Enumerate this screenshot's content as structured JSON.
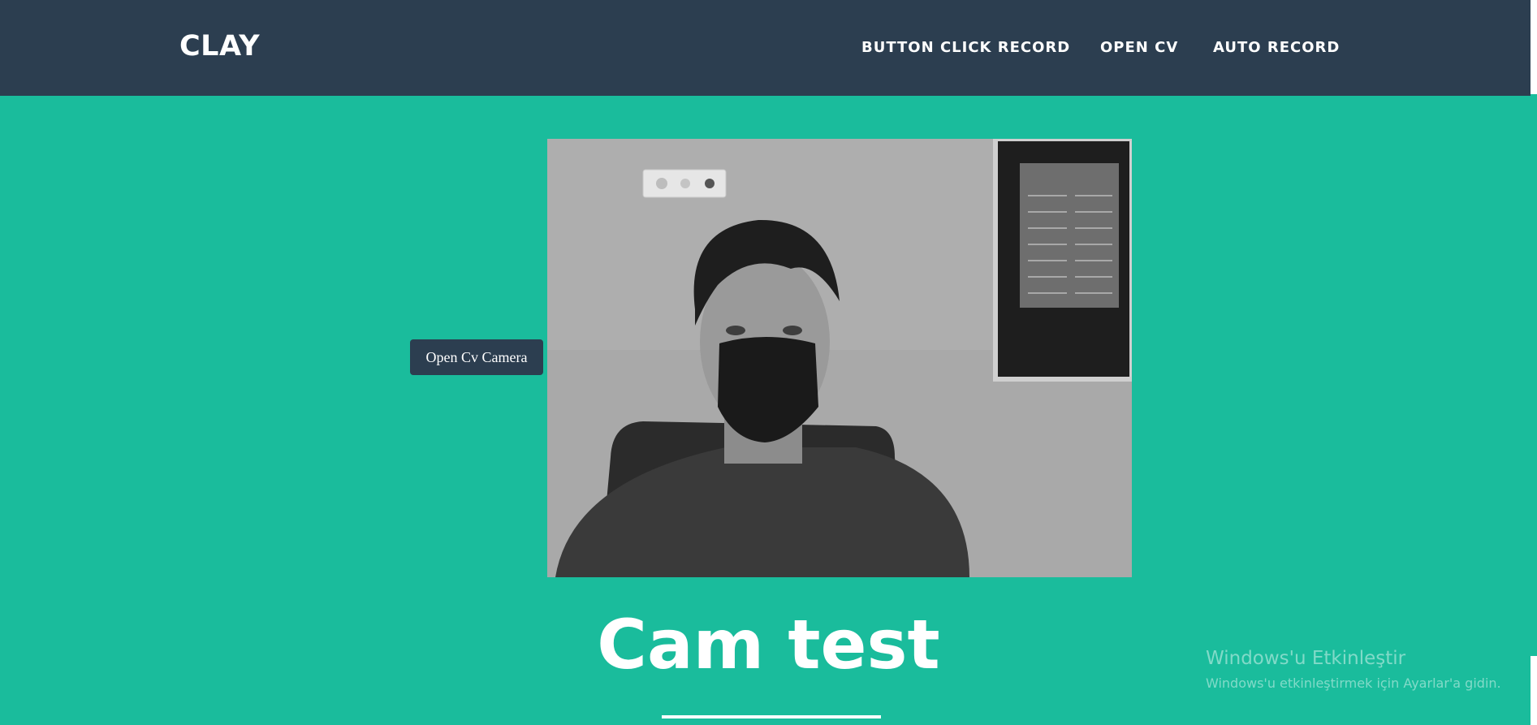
{
  "navbar": {
    "brand": "CLAY",
    "links": [
      "BUTTON CLICK RECORD",
      "OPEN CV",
      "AUTO RECORD"
    ]
  },
  "camera": {
    "button_label": "Open Cv Camera"
  },
  "main": {
    "title": "Cam test"
  },
  "watermark": {
    "title": "Windows'u Etkinleştir",
    "subtitle": "Windows'u etkinleştirmek için Ayarlar'a gidin."
  },
  "colors": {
    "navbar": "#2c3e50",
    "background": "#1abc9c",
    "button": "#2c3e50"
  }
}
